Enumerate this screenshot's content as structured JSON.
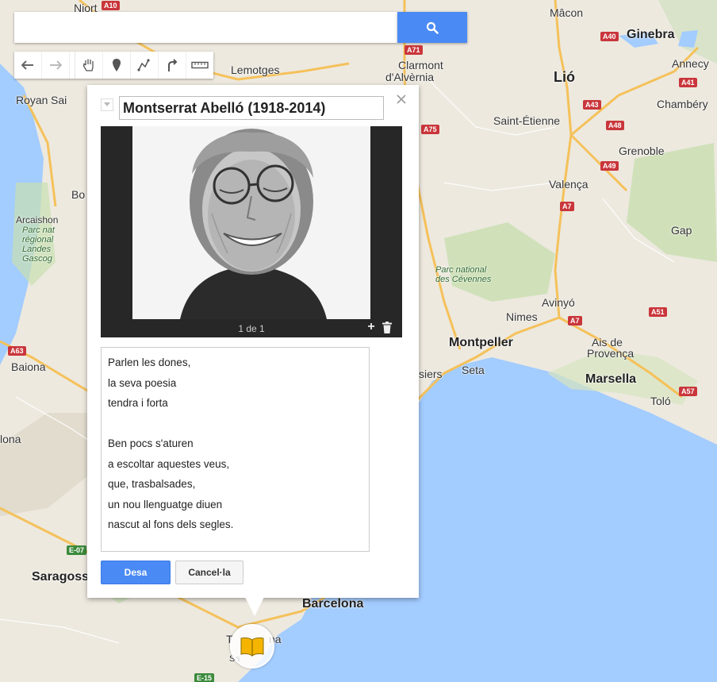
{
  "search": {
    "placeholder": ""
  },
  "toolbar": {
    "tools": [
      "undo-icon",
      "redo-icon",
      "hand-icon",
      "marker-icon",
      "line-icon",
      "directions-icon",
      "ruler-icon"
    ]
  },
  "popup": {
    "title": "Montserrat Abelló (1918-2014)",
    "photo_counter": "1 de 1",
    "add_label": "+",
    "description": "Parlen les dones,\nla seva poesia\ntendra i forta\n\nBen pocs s'aturen\na escoltar aquestes veus,\nque, trasbalsades,\nun nou llenguatge diuen\nnascut al fons dels segles.",
    "save_label": "Desa",
    "cancel_label": "Cancel·la"
  },
  "map": {
    "labels": {
      "niort": "Niort",
      "macon": "Mâcon",
      "ginebra": "Ginebra",
      "annecy": "Annecy",
      "clarmont": "Clarmont",
      "dalvernia": "d'Alvèrnia",
      "lemotges": "Lemotges",
      "lio": "Lió",
      "chambery": "Chambéry",
      "royan": "Royan",
      "sai": "Sai",
      "saint_etienne": "Saint-Étienne",
      "grenoble": "Grenoble",
      "bo": "Bo",
      "valenca": "Valença",
      "arcaishon": "Arcaishon",
      "parc_landes": "Parc nat\nrégional\nLandes\nGascog",
      "gap": "Gap",
      "parc_cevennes": "Parc national\ndes Cévennes",
      "avinyo": "Avinyó",
      "nimes": "Nimes",
      "montpeller": "Montpeller",
      "ais": "Ais de",
      "provenca": "Provença",
      "baiona": "Baiona",
      "siers": "siers",
      "seta": "Seta",
      "marsella": "Marsella",
      "tolo": "Toló",
      "lona": "lona",
      "saragoss": "Saragoss",
      "barcelona": "Barcelona",
      "ta": "T",
      "na": "na",
      "salou": "Sa"
    },
    "roads": {
      "a10": "A10",
      "a71": "A71",
      "a40": "A40",
      "a41": "A41",
      "a43": "A43",
      "a48": "A48",
      "a49": "A49",
      "a75": "A75",
      "a7": "A7",
      "a7b": "A7",
      "a51": "A51",
      "a57": "A57",
      "a63": "A63",
      "e07": "E-07",
      "e15": "E-15"
    }
  },
  "colors": {
    "accent": "#4a8af4",
    "sea": "#a3ccff",
    "land": "#ede9df",
    "marker": "#f4b400"
  }
}
